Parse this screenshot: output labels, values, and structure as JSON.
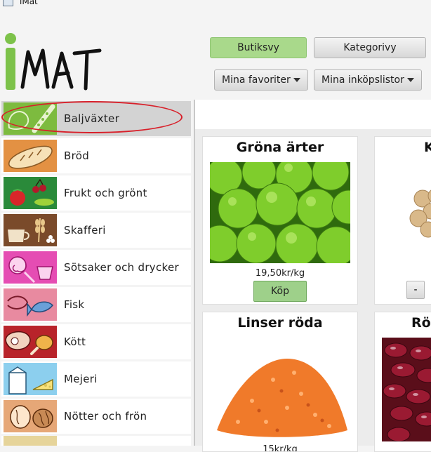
{
  "window": {
    "title": "iMat"
  },
  "header": {
    "logo_text": "iMAT",
    "store_view_label": "Butiksvy",
    "category_view_label": "Kategorivy",
    "favorites_label": "Mina favoriter",
    "lists_label": "Mina inköpslistor"
  },
  "sidebar": {
    "items": [
      {
        "label": "Baljväxter",
        "selected": true,
        "icon": "legumes-icon"
      },
      {
        "label": "Bröd",
        "icon": "bread-icon"
      },
      {
        "label": "Frukt och grönt",
        "icon": "fruit-vegetables-icon"
      },
      {
        "label": "Skafferi",
        "icon": "pantry-icon"
      },
      {
        "label": "Sötsaker och drycker",
        "icon": "sweets-drinks-icon"
      },
      {
        "label": "Fisk",
        "icon": "fish-icon"
      },
      {
        "label": "Kött",
        "icon": "meat-icon"
      },
      {
        "label": "Mejeri",
        "icon": "dairy-icon"
      },
      {
        "label": "Nötter och frön",
        "icon": "nuts-seeds-icon"
      }
    ]
  },
  "products": [
    {
      "name": "Gröna ärter",
      "price": "19,50kr/kg",
      "buy_label": "Köp"
    },
    {
      "name": "K",
      "minus_label": "-"
    },
    {
      "name": "Linser röda",
      "price": "15kr/kg"
    },
    {
      "name": "Rö"
    }
  ],
  "colors": {
    "accent_green": "#a9d98b",
    "highlight_red": "#d8202a"
  }
}
